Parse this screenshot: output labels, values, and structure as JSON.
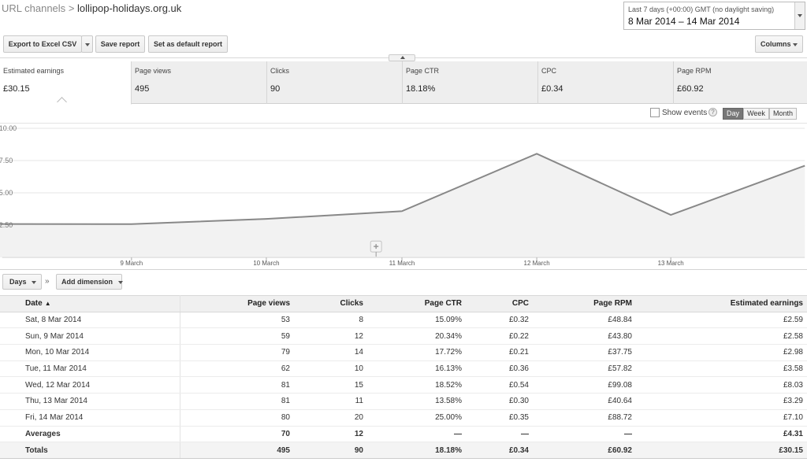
{
  "breadcrumb": {
    "parent": "URL channels",
    "separator": ">",
    "current": "lollipop-holidays.org.uk"
  },
  "daterange": {
    "preset": "Last 7 days (+00:00) GMT (no daylight saving)",
    "range": "8 Mar 2014 – 14 Mar 2014"
  },
  "toolbar": {
    "export_label": "Export to Excel CSV",
    "save_label": "Save report",
    "default_label": "Set as default report",
    "columns_label": "Columns"
  },
  "scorecards": [
    {
      "label": "Estimated earnings",
      "value": "£30.15"
    },
    {
      "label": "Page views",
      "value": "495"
    },
    {
      "label": "Clicks",
      "value": "90"
    },
    {
      "label": "Page CTR",
      "value": "18.18%"
    },
    {
      "label": "CPC",
      "value": "£0.34"
    },
    {
      "label": "Page RPM",
      "value": "£60.92"
    }
  ],
  "chart_controls": {
    "show_events_label": "Show events",
    "help_glyph": "?",
    "granularity": [
      "Day",
      "Week",
      "Month"
    ],
    "selected_granularity": "Day"
  },
  "chart_data": {
    "type": "line",
    "x": [
      "8 Mar 2014",
      "9 Mar 2014",
      "10 Mar 2014",
      "11 Mar 2014",
      "12 Mar 2014",
      "13 Mar 2014",
      "14 Mar 2014"
    ],
    "tick_labels": [
      "9 March",
      "10 March",
      "11 March",
      "12 March",
      "13 March"
    ],
    "y_tick_labels": [
      "10.00",
      "7.50",
      "5.00",
      "2.50"
    ],
    "ylim": [
      0,
      10
    ],
    "series": [
      {
        "values": [
          2.59,
          2.58,
          2.98,
          3.58,
          8.03,
          3.29,
          7.1
        ],
        "color": "#888888"
      }
    ],
    "grid": true
  },
  "table_controls": {
    "group_label": "Days",
    "chevron": "»",
    "add_dimension_label": "Add dimension"
  },
  "table": {
    "headers": [
      "Date",
      "Page views",
      "Clicks",
      "Page CTR",
      "CPC",
      "Page RPM",
      "Estimated earnings"
    ],
    "sort_indicator": "▲",
    "rows": [
      [
        "Sat, 8 Mar 2014",
        "53",
        "8",
        "15.09%",
        "£0.32",
        "£48.84",
        "£2.59"
      ],
      [
        "Sun, 9 Mar 2014",
        "59",
        "12",
        "20.34%",
        "£0.22",
        "£43.80",
        "£2.58"
      ],
      [
        "Mon, 10 Mar 2014",
        "79",
        "14",
        "17.72%",
        "£0.21",
        "£37.75",
        "£2.98"
      ],
      [
        "Tue, 11 Mar 2014",
        "62",
        "10",
        "16.13%",
        "£0.36",
        "£57.82",
        "£3.58"
      ],
      [
        "Wed, 12 Mar 2014",
        "81",
        "15",
        "18.52%",
        "£0.54",
        "£99.08",
        "£8.03"
      ],
      [
        "Thu, 13 Mar 2014",
        "81",
        "11",
        "13.58%",
        "£0.30",
        "£40.64",
        "£3.29"
      ],
      [
        "Fri, 14 Mar 2014",
        "80",
        "20",
        "25.00%",
        "£0.35",
        "£88.72",
        "£7.10"
      ]
    ],
    "averages": [
      "Averages",
      "70",
      "12",
      "—",
      "—",
      "—",
      "£4.31"
    ],
    "totals": [
      "Totals",
      "495",
      "90",
      "18.18%",
      "£0.34",
      "£60.92",
      "£30.15"
    ]
  }
}
